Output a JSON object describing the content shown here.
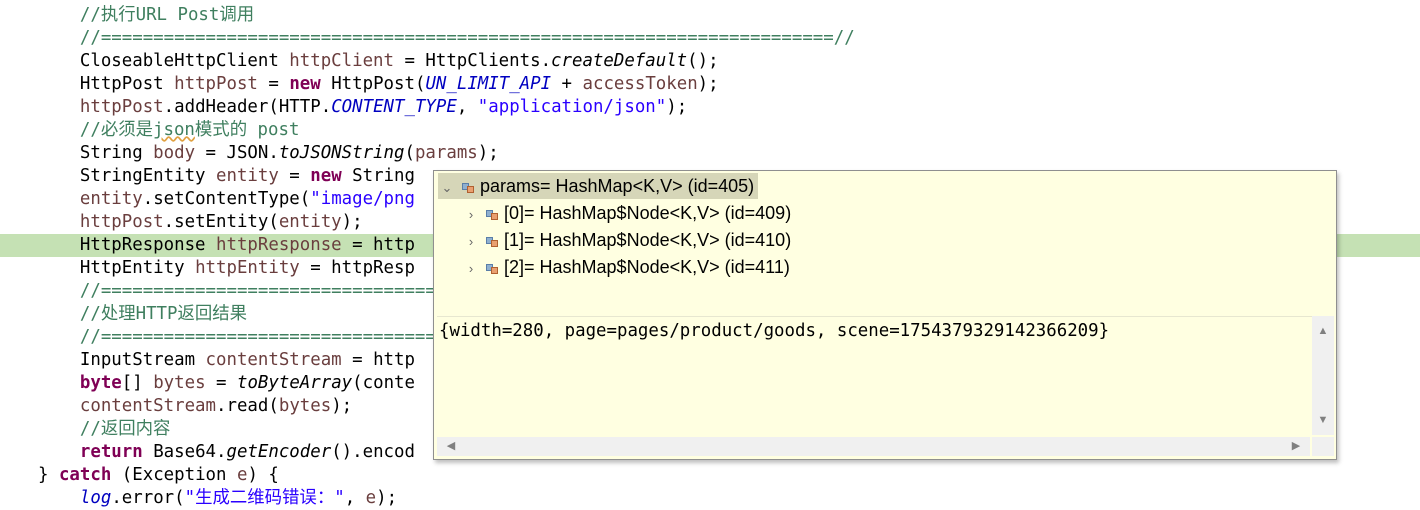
{
  "editor": {
    "line_height_note": "",
    "lines": [
      {
        "segs": [
          {
            "t": "    ",
            "c": ""
          },
          {
            "t": "//执行URL Post调用",
            "c": "cmt"
          }
        ]
      },
      {
        "segs": [
          {
            "t": "    ",
            "c": ""
          },
          {
            "t": "//======================================================================//",
            "c": "cmt"
          }
        ]
      },
      {
        "segs": [
          {
            "t": "    CloseableHttpClient ",
            "c": ""
          },
          {
            "t": "httpClient",
            "c": "var"
          },
          {
            "t": " = HttpClients.",
            "c": ""
          },
          {
            "t": "createDefault",
            "c": "smeth"
          },
          {
            "t": "();",
            "c": ""
          }
        ]
      },
      {
        "segs": [
          {
            "t": "    HttpPost ",
            "c": ""
          },
          {
            "t": "httpPost",
            "c": "var"
          },
          {
            "t": " = ",
            "c": ""
          },
          {
            "t": "new",
            "c": "kw"
          },
          {
            "t": " HttpPost(",
            "c": ""
          },
          {
            "t": "UN_LIMIT_API",
            "c": "fld"
          },
          {
            "t": " + ",
            "c": ""
          },
          {
            "t": "accessToken",
            "c": "var"
          },
          {
            "t": ");",
            "c": ""
          }
        ]
      },
      {
        "segs": [
          {
            "t": "    ",
            "c": ""
          },
          {
            "t": "httpPost",
            "c": "var"
          },
          {
            "t": ".addHeader(HTTP.",
            "c": ""
          },
          {
            "t": "CONTENT_TYPE",
            "c": "fld"
          },
          {
            "t": ", ",
            "c": ""
          },
          {
            "t": "\"application/json\"",
            "c": "str"
          },
          {
            "t": ");",
            "c": ""
          }
        ]
      },
      {
        "segs": [
          {
            "t": "    ",
            "c": ""
          },
          {
            "t": "//必须是",
            "c": "cmt"
          },
          {
            "t": "json",
            "c": "cmt spell"
          },
          {
            "t": "模式的 post",
            "c": "cmt"
          }
        ]
      },
      {
        "segs": [
          {
            "t": "    String ",
            "c": ""
          },
          {
            "t": "body",
            "c": "var"
          },
          {
            "t": " = JSON.",
            "c": ""
          },
          {
            "t": "toJSONString",
            "c": "smeth"
          },
          {
            "t": "(",
            "c": ""
          },
          {
            "t": "params",
            "c": "var"
          },
          {
            "t": ");",
            "c": ""
          }
        ]
      },
      {
        "segs": [
          {
            "t": "    StringEntity ",
            "c": ""
          },
          {
            "t": "entity",
            "c": "var"
          },
          {
            "t": " = ",
            "c": ""
          },
          {
            "t": "new",
            "c": "kw"
          },
          {
            "t": " String",
            "c": ""
          }
        ]
      },
      {
        "segs": [
          {
            "t": "    ",
            "c": ""
          },
          {
            "t": "entity",
            "c": "var"
          },
          {
            "t": ".setContentType(",
            "c": ""
          },
          {
            "t": "\"image/png",
            "c": "str"
          }
        ]
      },
      {
        "segs": [
          {
            "t": "    ",
            "c": ""
          },
          {
            "t": "httpPost",
            "c": "var"
          },
          {
            "t": ".setEntity(",
            "c": ""
          },
          {
            "t": "entity",
            "c": "var"
          },
          {
            "t": ");",
            "c": ""
          }
        ]
      },
      {
        "segs": [
          {
            "t": "    HttpResponse ",
            "c": ""
          },
          {
            "t": "httpResponse",
            "c": "var"
          },
          {
            "t": " = http",
            "c": ""
          }
        ],
        "current": true
      },
      {
        "segs": [
          {
            "t": "    HttpEntity ",
            "c": ""
          },
          {
            "t": "httpEntity",
            "c": "var"
          },
          {
            "t": " = httpResp",
            "c": ""
          }
        ]
      },
      {
        "segs": [
          {
            "t": "    ",
            "c": ""
          },
          {
            "t": "//================================",
            "c": "cmt"
          }
        ]
      },
      {
        "segs": [
          {
            "t": "    ",
            "c": ""
          },
          {
            "t": "//处理HTTP返回结果",
            "c": "cmt"
          }
        ]
      },
      {
        "segs": [
          {
            "t": "    ",
            "c": ""
          },
          {
            "t": "//================================",
            "c": "cmt"
          }
        ]
      },
      {
        "segs": [
          {
            "t": "    InputStream ",
            "c": ""
          },
          {
            "t": "contentStream",
            "c": "var"
          },
          {
            "t": " = http",
            "c": ""
          }
        ]
      },
      {
        "segs": [
          {
            "t": "    ",
            "c": ""
          },
          {
            "t": "byte",
            "c": "kw"
          },
          {
            "t": "[] ",
            "c": ""
          },
          {
            "t": "bytes",
            "c": "var"
          },
          {
            "t": " = ",
            "c": ""
          },
          {
            "t": "toByteArray",
            "c": "smeth"
          },
          {
            "t": "(conte",
            "c": ""
          }
        ]
      },
      {
        "segs": [
          {
            "t": "    ",
            "c": ""
          },
          {
            "t": "contentStream",
            "c": "var"
          },
          {
            "t": ".read(",
            "c": ""
          },
          {
            "t": "bytes",
            "c": "var"
          },
          {
            "t": ");",
            "c": ""
          }
        ]
      },
      {
        "segs": [
          {
            "t": "    ",
            "c": ""
          },
          {
            "t": "//返回内容",
            "c": "cmt"
          }
        ]
      },
      {
        "segs": [
          {
            "t": "    ",
            "c": ""
          },
          {
            "t": "return",
            "c": "kw"
          },
          {
            "t": " Base64.",
            "c": ""
          },
          {
            "t": "getEncoder",
            "c": "smeth"
          },
          {
            "t": "().encod",
            "c": ""
          }
        ]
      },
      {
        "segs": [
          {
            "t": "} ",
            "c": ""
          },
          {
            "t": "catch",
            "c": "kw"
          },
          {
            "t": " (Exception ",
            "c": ""
          },
          {
            "t": "e",
            "c": "var"
          },
          {
            "t": ") {",
            "c": ""
          }
        ]
      },
      {
        "segs": [
          {
            "t": "    ",
            "c": ""
          },
          {
            "t": "log",
            "c": "fld"
          },
          {
            "t": ".error(",
            "c": ""
          },
          {
            "t": "\"生成二维码错误：\"",
            "c": "str"
          },
          {
            "t": ", ",
            "c": ""
          },
          {
            "t": "e",
            "c": "var"
          },
          {
            "t": ");",
            "c": ""
          }
        ]
      }
    ]
  },
  "inspect_popup": {
    "root": {
      "label": "params= HashMap<K,V>  (id=405)",
      "expanded": true
    },
    "children": [
      {
        "label": "[0]= HashMap$Node<K,V>  (id=409)"
      },
      {
        "label": "[1]= HashMap$Node<K,V>  (id=410)"
      },
      {
        "label": "[2]= HashMap$Node<K,V>  (id=411)"
      }
    ],
    "detail_text": "{width=280, page=pages/product/goods, scene=1754379329142366209}"
  },
  "icons": {
    "expand": "chevron-down-icon",
    "collapsed": "chevron-right-icon",
    "scroll_up": "triangle-up-icon",
    "scroll_down": "triangle-down-icon",
    "scroll_left": "triangle-left-icon",
    "scroll_right": "triangle-right-icon"
  },
  "colors": {
    "current_line": "#c5e1b4",
    "popup_bg": "#ffffe1",
    "comment": "#3f7f5f",
    "keyword": "#7f0055",
    "string": "#2a00ff",
    "field": "#0000c0",
    "local_var": "#6a3e3e"
  }
}
